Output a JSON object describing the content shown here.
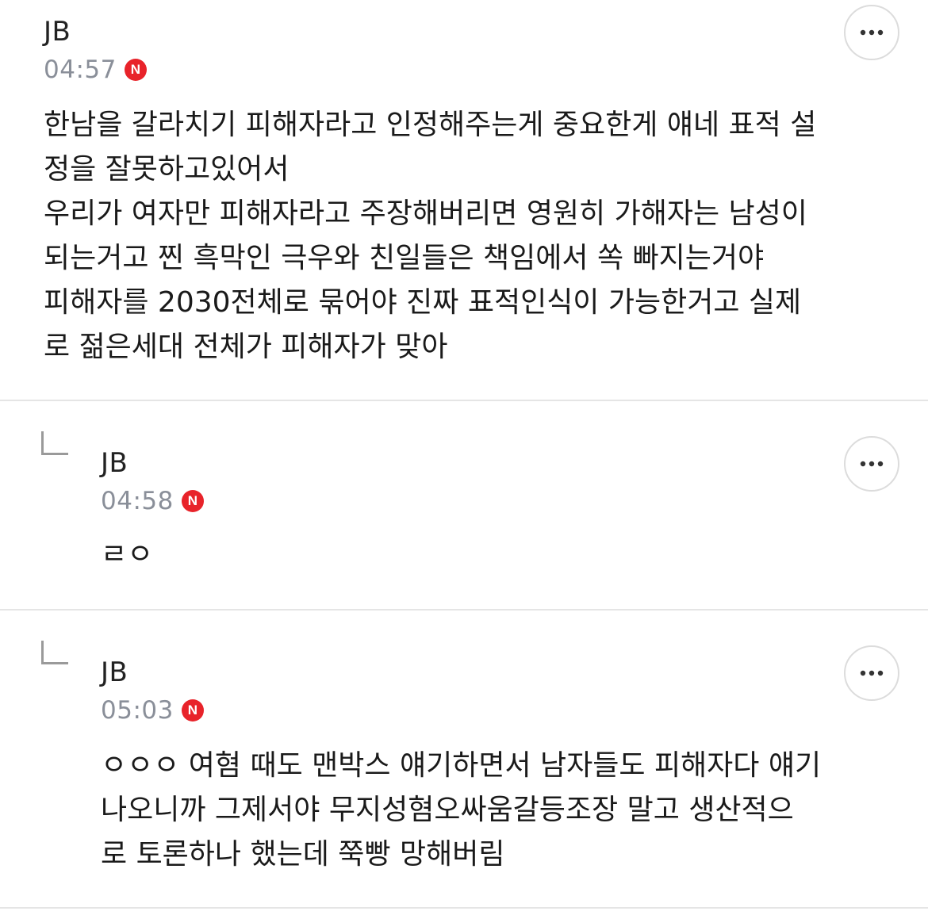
{
  "comments": [
    {
      "author": "JB",
      "time": "04:57",
      "badge": "N",
      "text": "한남을 갈라치기 피해자라고 인정해주는게 중요한게 얘네 표적 설\n정을 잘못하고있어서\n우리가 여자만 피해자라고 주장해버리면 영원히 가해자는 남성이\n되는거고 찐 흑막인 극우와 친일들은 책임에서 쏙 빠지는거야\n피해자를 2030전체로 묶어야 진짜 표적인식이 가능한거고 실제\n로 젊은세대 전체가 피해자가 맞아",
      "more_icon": "more-horizontal-icon"
    },
    {
      "author": "JB",
      "time": "04:58",
      "badge": "N",
      "text": "ㄹㅇ",
      "is_reply": true,
      "reply_icon": "reply-arrow-icon",
      "more_icon": "more-horizontal-icon"
    },
    {
      "author": "JB",
      "time": "05:03",
      "badge": "N",
      "text": "ㅇㅇㅇ 여혐 때도 맨박스 얘기하면서 남자들도 피해자다 얘기\n나오니까 그제서야 무지성혐오싸움갈등조장 말고 생산적으\n로 토론하나 했는데 쭉빵 망해버림",
      "is_reply": true,
      "reply_icon": "reply-arrow-icon",
      "more_icon": "more-horizontal-icon"
    }
  ],
  "colors": {
    "badge": "#e8232a",
    "time": "#8a8f99",
    "divider": "#e5e5e5"
  }
}
